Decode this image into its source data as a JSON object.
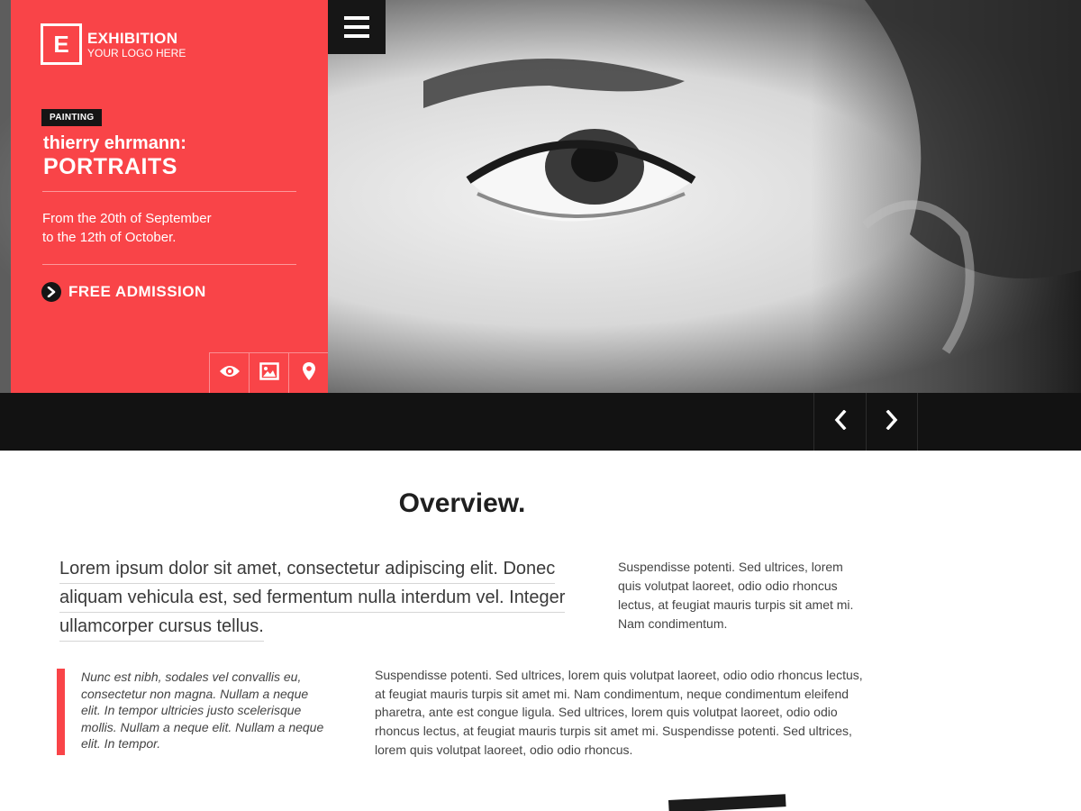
{
  "logo": {
    "letter": "E",
    "title": "EXHIBITION",
    "tagline": "YOUR LOGO HERE"
  },
  "hero": {
    "category": "PAINTING",
    "artist": "thierry ehrmann:",
    "title": "PORTRAITS",
    "dates_line1": "From the 20th of September",
    "dates_line2": "to the 12th of October.",
    "admission_label": "FREE ADMISSION"
  },
  "icons": {
    "menu": "menu-icon",
    "admission": "chevron-right-circle-icon",
    "actions": [
      "eye-icon",
      "image-icon",
      "map-pin-icon"
    ],
    "prev": "chevron-left-icon",
    "next": "chevron-right-icon"
  },
  "colors": {
    "accent": "#f94448",
    "dark": "#121212"
  },
  "overview": {
    "heading": "Overview.",
    "lead_lines": [
      "Lorem ipsum dolor sit amet, consectetur adipiscing elit. Donec",
      "aliquam vehicula est, sed fermentum nulla interdum vel. Integer",
      "ullamcorper cursus tellus."
    ],
    "side_text": "Suspendisse potenti. Sed ultrices, lorem quis volutpat laoreet, odio odio rhoncus lectus, at feugiat mauris turpis sit amet mi. Nam condimentum.",
    "quote": "Nunc est nibh, sodales vel convallis eu, consectetur non magna. Nullam a neque elit. In tempor ultricies justo scelerisque mollis. Nullam a neque elit. Nullam a neque elit. In tempor.",
    "body": "Suspendisse potenti. Sed ultrices, lorem quis volutpat laoreet, odio odio rhoncus lectus, at feugiat mauris turpis sit amet mi. Nam condimentum, neque condimentum eleifend pharetra, ante est congue ligula. Sed ultrices, lorem quis volutpat laoreet, odio odio rhoncus lectus, at feugiat mauris turpis sit amet mi. Suspendisse potenti. Sed ultrices, lorem quis volutpat laoreet, odio odio rhoncus."
  }
}
